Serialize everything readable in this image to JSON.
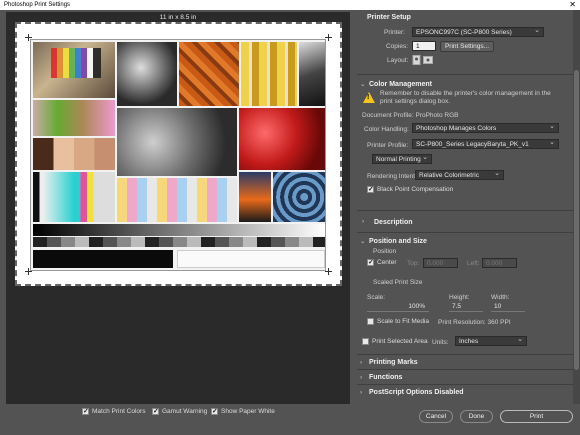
{
  "window": {
    "title": "Photoshop Print Settings",
    "close_glyph": "✕"
  },
  "preview": {
    "paper_size": "11 in x 8.5 in",
    "swatch_colors": [
      "#d92b2b",
      "#e68a2e",
      "#f2e13a",
      "#5fb34a",
      "#2e7fd0",
      "#7b3fb8",
      "#e84fa1",
      "#2ad0d0",
      "#ffffff",
      "#000000"
    ],
    "gray_steps": 20,
    "scale_numbers_top": [
      "1",
      "2",
      "3",
      "4",
      "5",
      "6",
      "7",
      "8",
      "9",
      "10",
      "11",
      "12",
      "13",
      "14",
      "15",
      "16",
      "17",
      "18",
      "19",
      "20",
      "21"
    ],
    "scale_numbers_bottom": [
      "21",
      "22",
      "23",
      "24",
      "25",
      "26",
      "27",
      "28",
      "29",
      "30",
      "31",
      "32",
      "33",
      "34",
      "35",
      "36",
      "37",
      "38",
      "39",
      "40",
      "41"
    ]
  },
  "bottom_options": {
    "match_print_colors": "Match Print Colors",
    "gamut_warning": "Gamut Warning",
    "show_paper_white": "Show Paper White"
  },
  "printer_setup": {
    "title": "Printer Setup",
    "printer_label": "Printer:",
    "printer_value": "EPSONC997C (SC-P800 Series)",
    "copies_label": "Copies:",
    "copies_value": "1",
    "print_settings_button": "Print Settings...",
    "layout_label": "Layout:"
  },
  "color_management": {
    "title": "Color Management",
    "warning": "Remember to disable the printer's color management in the print settings dialog box.",
    "document_profile": "Document Profile: ProPhoto RGB",
    "color_handling_label": "Color Handling:",
    "color_handling_value": "Photoshop Manages Colors",
    "printer_profile_label": "Printer Profile:",
    "printer_profile_value": "SC-P800_Series LegacyBaryta_PK_v1",
    "normal_printing": "Normal Printing",
    "rendering_intent_label": "Rendering Intent:",
    "rendering_intent_value": "Relative Colorimetric",
    "black_point": "Black Point Compensation"
  },
  "description": {
    "title": "Description"
  },
  "position_size": {
    "title": "Position and Size",
    "position_label": "Position",
    "center": "Center",
    "top_label": "Top:",
    "top_value": "0.000",
    "left_label": "Left:",
    "left_value": "0.000",
    "scaled_label": "Scaled Print Size",
    "scale_label": "Scale:",
    "scale_value": "100%",
    "height_label": "Height:",
    "height_value": "7.5",
    "width_label": "Width:",
    "width_value": "10",
    "scale_to_fit": "Scale to Fit Media",
    "print_resolution": "Print Resolution: 360 PPI",
    "print_selected_area": "Print Selected Area",
    "units_label": "Units:",
    "units_value": "Inches"
  },
  "collapsed_sections": {
    "printing_marks": "Printing Marks",
    "functions": "Functions",
    "postscript": "PostScript Options Disabled"
  },
  "footer": {
    "cancel": "Cancel",
    "done": "Done",
    "print": "Print"
  }
}
